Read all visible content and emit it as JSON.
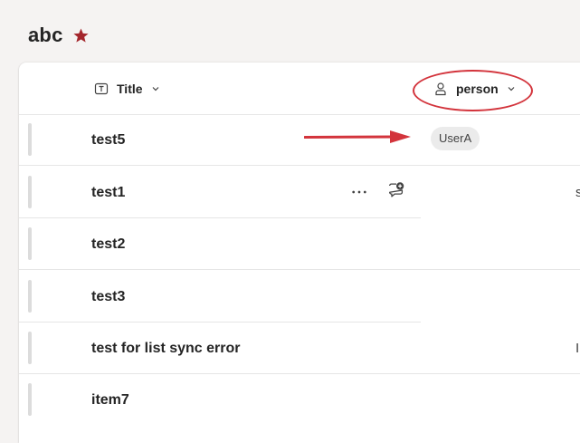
{
  "list": {
    "title": "abc",
    "favorite": true
  },
  "colors": {
    "accent_red": "#a4262c",
    "annotation_red": "#d3343c",
    "pill_bg": "#ebebeb"
  },
  "columns": [
    {
      "label": "Title",
      "icon": "text-field-icon"
    },
    {
      "label": "person",
      "icon": "person-icon"
    }
  ],
  "rows": [
    {
      "title": "test5",
      "person": "UserA",
      "edge_text": ""
    },
    {
      "title": "test1",
      "person": "",
      "edge_text": "s"
    },
    {
      "title": "test2",
      "person": "",
      "edge_text": ""
    },
    {
      "title": "test3",
      "person": "",
      "edge_text": ""
    },
    {
      "title": "test for list sync error",
      "person": "",
      "edge_text": "I"
    },
    {
      "title": "item7",
      "person": "",
      "edge_text": ""
    }
  ]
}
